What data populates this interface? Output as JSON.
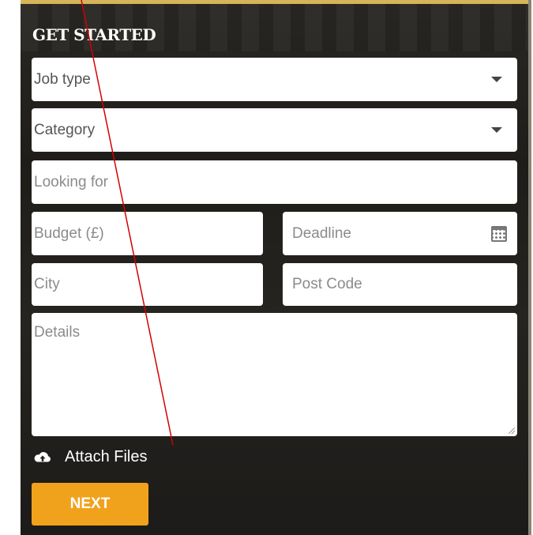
{
  "form": {
    "heading": "GET STARTED",
    "job_type": {
      "value": "Job type",
      "icon": "chevron-down-icon"
    },
    "category": {
      "value": "Category",
      "icon": "chevron-down-icon"
    },
    "looking_for": {
      "placeholder": "Looking for"
    },
    "budget": {
      "placeholder": "Budget (£)"
    },
    "deadline": {
      "placeholder": "Deadline",
      "icon": "calendar-icon"
    },
    "city": {
      "placeholder": "City"
    },
    "post_code": {
      "placeholder": "Post Code"
    },
    "details": {
      "placeholder": "Details"
    },
    "attach_files": {
      "label": "Attach Files",
      "icon": "cloud-upload-icon"
    },
    "next_button": {
      "label": "NEXT"
    }
  },
  "colors": {
    "panel_bg": "#23211e",
    "accent_gold": "#d6b45a",
    "button_orange": "#f1a21c",
    "annotation_red": "#d40000"
  }
}
